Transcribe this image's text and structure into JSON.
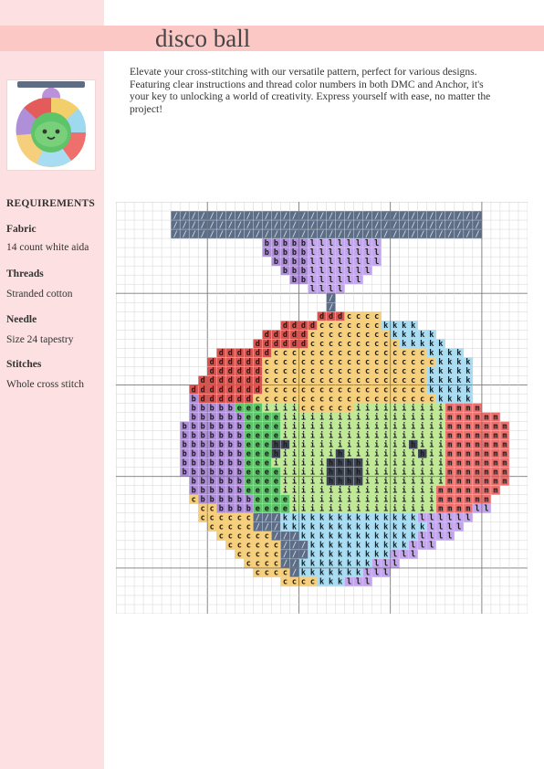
{
  "title": "disco ball",
  "description": "Elevate your cross-stitching with our versatile pattern, perfect for various designs. Featuring clear instructions and thread color numbers in both DMC and Anchor, it's your key to unlocking a world of creativity. Express yourself with ease, no matter the project!",
  "requirements": {
    "heading": "REQUIREMENTS",
    "items": [
      {
        "label": "Fabric",
        "value": "14 count white aida"
      },
      {
        "label": "Threads",
        "value": "Stranded cotton"
      },
      {
        "label": "Needle",
        "value": "Size 24 tapestry"
      },
      {
        "label": "Stitches",
        "value": "Whole cross stitch"
      }
    ]
  },
  "palette": {
    "/": "#5d6d86",
    "b": "#ae8fd8",
    "l": "#c4a6ee",
    "d": "#d9534f",
    "c": "#f5cf7c",
    "k": "#a8dcf2",
    "m": "#ef6f6c",
    "e": "#5ec46a",
    "i": "#bfe897",
    "h": "#3e4450"
  },
  "pattern": {
    "width": 45,
    "rows": [
      ".............................................",
      "......//////////////////////////////////.....",
      "......//////////////////////////////////.....",
      "......//////////////////////////////////.....",
      "................bbbbbllllllll................",
      "................bbbbbllllllll................",
      ".................bbbbllllllll................",
      "..................bbblllllll.................",
      "...................bbllllll..................",
      ".....................llll....................",
      "......................./.....................",
      "......................./.....................",
      "......................dddcccc................",
      "..................ddddccccccckkkk............",
      "................dddddccccccccckkkkk..........",
      "...............ddddddcccccccccckkkkk.........",
      "...........ddddddccccccccccccccccckkkk.......",
      "..........ddddddccccccccccccccccccckkkk......",
      "..........ddddddcccccccccccccccccckkkkk......",
      ".........dddddddcccccccccccccccccckkkkk......",
      "........ddddddddcccccccccccccccccckkkkk......",
      "........bddddddcccccccccccccccccccckkkk......",
      "........bbbbbeeeiiiicccccciiiiiiiiiimmmm.....",
      "........bbbbbbeeeeiiiiiiiiiiiiiiiiiimmmmmm...",
      ".......bbbbbbbeeeeiiiiiiiiiiiiiiiiiimmmmmmm..",
      ".......bbbbbbbeeeeiiiiiiiiiiiiiiiiiimmmmmmm..",
      ".......bbbbbbbeeehhiiiiiiiiiiiiihiiimmmmmmm..",
      ".......bbbbbbbeeehiiiiiihiiiiiiiihiimmmmmmm..",
      ".......bbbbbbbeeeiiiiiihhhhiiiiiiiiimmmmmmm..",
      ".......bbbbbbbeeeeiiiiihhhhiiiiiiiiimmmmmmm..",
      "........bbbbbbeeeeiiiiihhhhiiiiiiiiimmmmmmm..",
      "........bbbbbbeeeeiiiiiiiiiiiiiiiiimmmmmmm...",
      "........cbbbbbbeeeeiiiiiiiiiiiiiiiimmmmmm....",
      ".........ccbbbbeeeeiiiiiiiiiiiiiiiimmmmll....",
      ".........cccccc///kkkkkkkkkkkkkkkllllll......",
      "..........ccccc///kkkkkkkkkkkkkkkkllll.......",
      "...........cccccc///kkkkkkkkkkkkkllll........",
      "............cccccc///kkkkkkkkkkklll..........",
      ".............ccccc///kkkkkkkkklll............",
      "..............cccc//kkkkkkkklll..............",
      "...............cccc/kkkkkkklll...............",
      "..................cccckkklll.................",
      "............................................."
    ]
  }
}
